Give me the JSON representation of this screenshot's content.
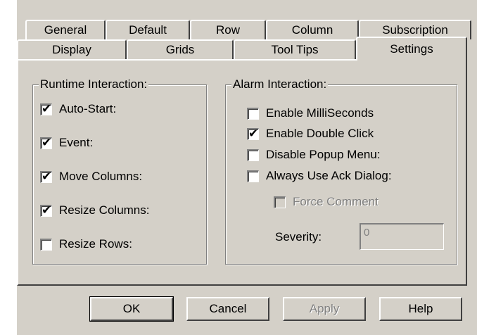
{
  "tabs_row1": [
    "General",
    "Default",
    "Row",
    "Column",
    "Subscription"
  ],
  "tabs_row2": [
    "Display",
    "Grids",
    "Tool Tips",
    "Settings"
  ],
  "runtime": {
    "title": "Runtime Interaction:",
    "items": [
      {
        "label": "Auto-Start:",
        "checked": true
      },
      {
        "label": "Event:",
        "checked": true
      },
      {
        "label": "Move Columns:",
        "checked": true
      },
      {
        "label": "Resize Columns:",
        "checked": true
      },
      {
        "label": "Resize Rows:",
        "checked": false
      }
    ]
  },
  "alarm": {
    "title": "Alarm Interaction:",
    "items": [
      {
        "label": "Enable MilliSeconds",
        "checked": false
      },
      {
        "label": "Enable Double Click",
        "checked": true
      },
      {
        "label": "Disable Popup Menu:",
        "checked": false
      },
      {
        "label": "Always Use Ack Dialog:",
        "checked": false
      }
    ],
    "force_comment": {
      "label": "Force Comment",
      "checked": false
    },
    "severity_label": "Severity:",
    "severity_value": "0"
  },
  "buttons": {
    "ok": "OK",
    "cancel": "Cancel",
    "apply": "Apply",
    "help": "Help"
  },
  "check_mark": "✔"
}
